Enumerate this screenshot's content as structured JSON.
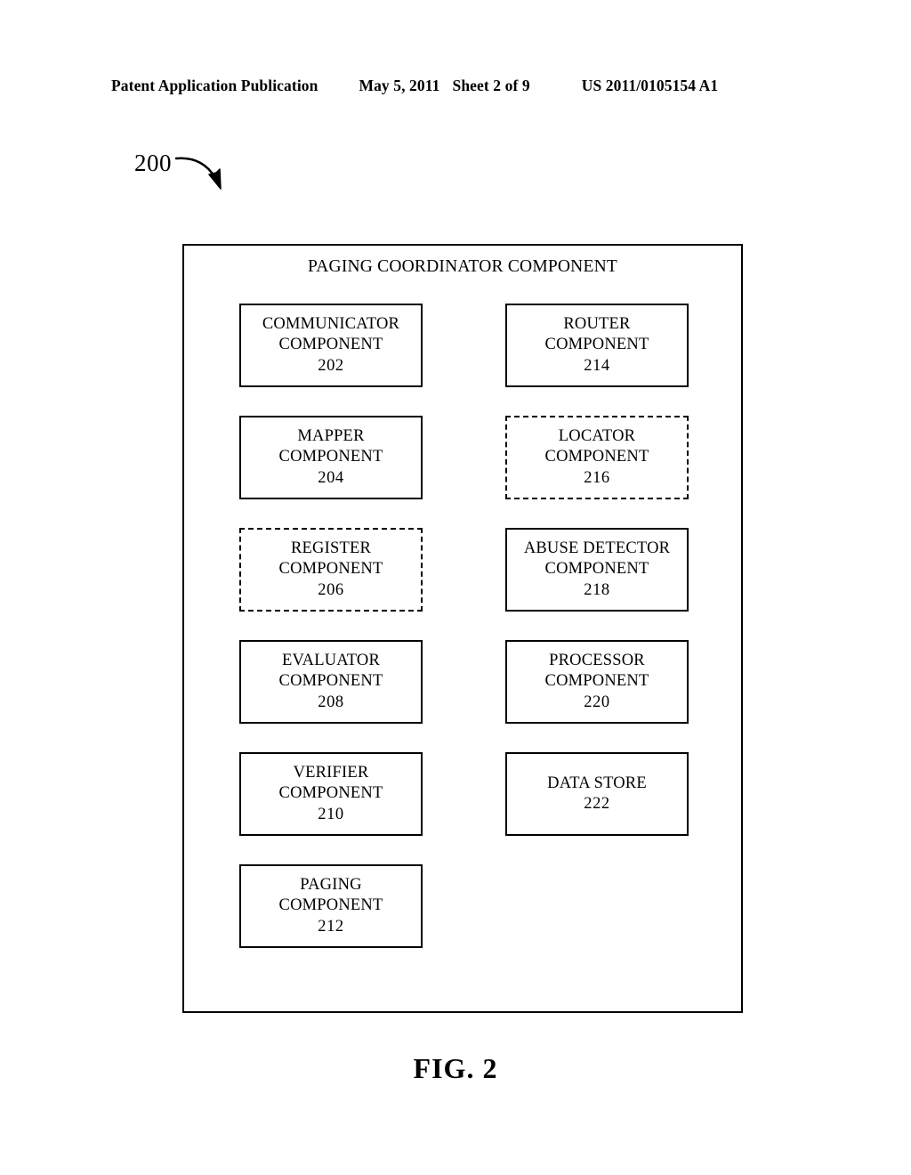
{
  "header": {
    "publication": "Patent Application Publication",
    "date": "May 5, 2011",
    "sheet": "Sheet 2 of 9",
    "patent_number": "US 2011/0105154 A1"
  },
  "figure": {
    "reference_numeral": "200",
    "caption": "FIG. 2",
    "arrow_icon": "curved-arrow-icon"
  },
  "diagram": {
    "container": {
      "title": "PAGING COORDINATOR COMPONENT",
      "border_style": "solid"
    },
    "left_column": [
      {
        "name": "COMMUNICATOR",
        "type": "COMPONENT",
        "numeral": "202",
        "border_style": "solid"
      },
      {
        "name": "MAPPER",
        "type": "COMPONENT",
        "numeral": "204",
        "border_style": "solid"
      },
      {
        "name": "REGISTER",
        "type": "COMPONENT",
        "numeral": "206",
        "border_style": "dashed"
      },
      {
        "name": "EVALUATOR",
        "type": "COMPONENT",
        "numeral": "208",
        "border_style": "solid"
      },
      {
        "name": "VERIFIER",
        "type": "COMPONENT",
        "numeral": "210",
        "border_style": "solid"
      },
      {
        "name": "PAGING",
        "type": "COMPONENT",
        "numeral": "212",
        "border_style": "solid"
      }
    ],
    "right_column": [
      {
        "name": "ROUTER",
        "type": "COMPONENT",
        "numeral": "214",
        "border_style": "solid"
      },
      {
        "name": "LOCATOR",
        "type": "COMPONENT",
        "numeral": "216",
        "border_style": "dashed"
      },
      {
        "name": "ABUSE DETECTOR",
        "type": "COMPONENT",
        "numeral": "218",
        "border_style": "solid"
      },
      {
        "name": "PROCESSOR",
        "type": "COMPONENT",
        "numeral": "220",
        "border_style": "solid"
      },
      {
        "name": "DATA STORE",
        "type": "",
        "numeral": "222",
        "border_style": "solid"
      }
    ]
  },
  "colors": {
    "ink": "#000000",
    "paper": "#ffffff"
  }
}
